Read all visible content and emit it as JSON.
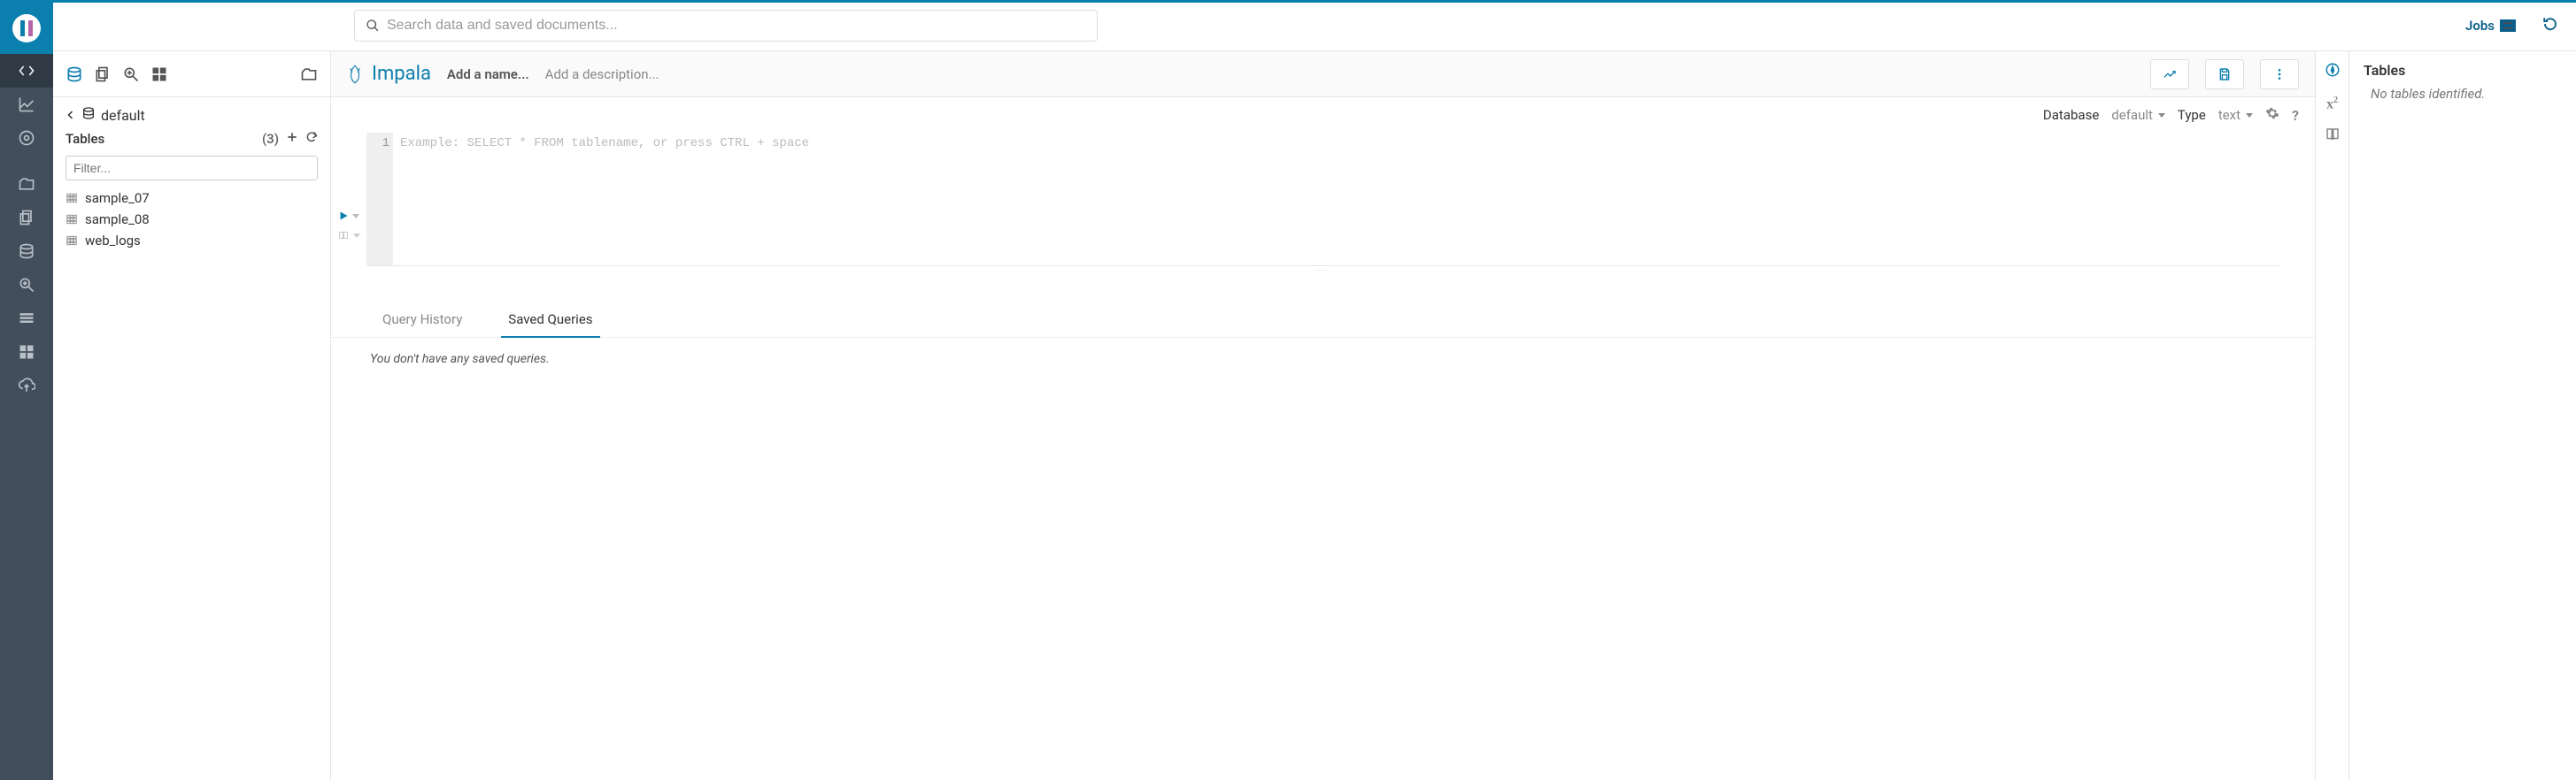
{
  "topbar": {
    "search_placeholder": "Search data and saved documents...",
    "jobs_label": "Jobs"
  },
  "nav": {
    "items": [
      "editor",
      "dashboard",
      "scheduler",
      "documents",
      "files",
      "tables",
      "indexes",
      "security",
      "importer",
      "admin"
    ]
  },
  "assist": {
    "breadcrumb_db": "default",
    "tables_label": "Tables",
    "tables_count": "(3)",
    "filter_placeholder": "Filter...",
    "tables": [
      "sample_07",
      "sample_08",
      "web_logs"
    ]
  },
  "editor": {
    "engine": "Impala",
    "name_placeholder": "Add a name...",
    "desc_placeholder": "Add a description...",
    "database_label": "Database",
    "database_value": "default",
    "type_label": "Type",
    "type_value": "text",
    "line_number": "1",
    "code_placeholder": "Example: SELECT * FROM tablename, or press CTRL + space",
    "tabs": {
      "history": "Query History",
      "saved": "Saved Queries"
    },
    "saved_empty_msg": "You don't have any saved queries."
  },
  "right": {
    "tables_title": "Tables",
    "tables_empty": "No tables identified."
  }
}
